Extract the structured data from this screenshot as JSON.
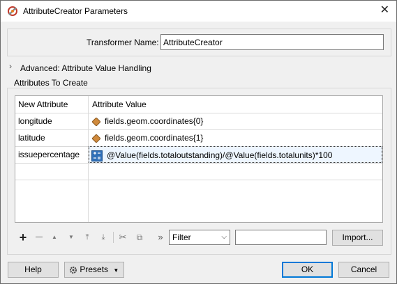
{
  "window": {
    "title": "AttributeCreator Parameters",
    "close_glyph": "✕"
  },
  "transformer_name": {
    "label": "Transformer Name:",
    "value": "AttributeCreator"
  },
  "advanced": {
    "label": "Advanced: Attribute Value Handling"
  },
  "attributes_group": {
    "label": "Attributes To Create"
  },
  "table": {
    "headers": {
      "name": "New Attribute",
      "value": "Attribute Value"
    },
    "rows": [
      {
        "name": "longitude",
        "value": "fields.geom.coordinates{0}",
        "icon": "attribute-diamond-icon"
      },
      {
        "name": "latitude",
        "value": "fields.geom.coordinates{1}",
        "icon": "attribute-diamond-icon"
      },
      {
        "name": "issuepercentage",
        "value": "@Value(fields.totaloutstanding)/@Value(fields.totalunits)*100",
        "icon": "arithmetic-editor-icon"
      }
    ]
  },
  "toolbar": {
    "add": "+",
    "remove": "—",
    "up": "▲",
    "down": "▼",
    "top": "⤒",
    "bottom": "⤓",
    "cut": "✂",
    "copy": "⧉",
    "more": "»",
    "filter_value": "Filter",
    "filter_text": "",
    "import_label": "Import..."
  },
  "footer": {
    "help": "Help",
    "presets": "Presets",
    "ok": "OK",
    "cancel": "Cancel"
  },
  "colors": {
    "accent": "#0078d7",
    "diamond": "#d08a3c",
    "editor_icon": "#2f6fb7"
  }
}
